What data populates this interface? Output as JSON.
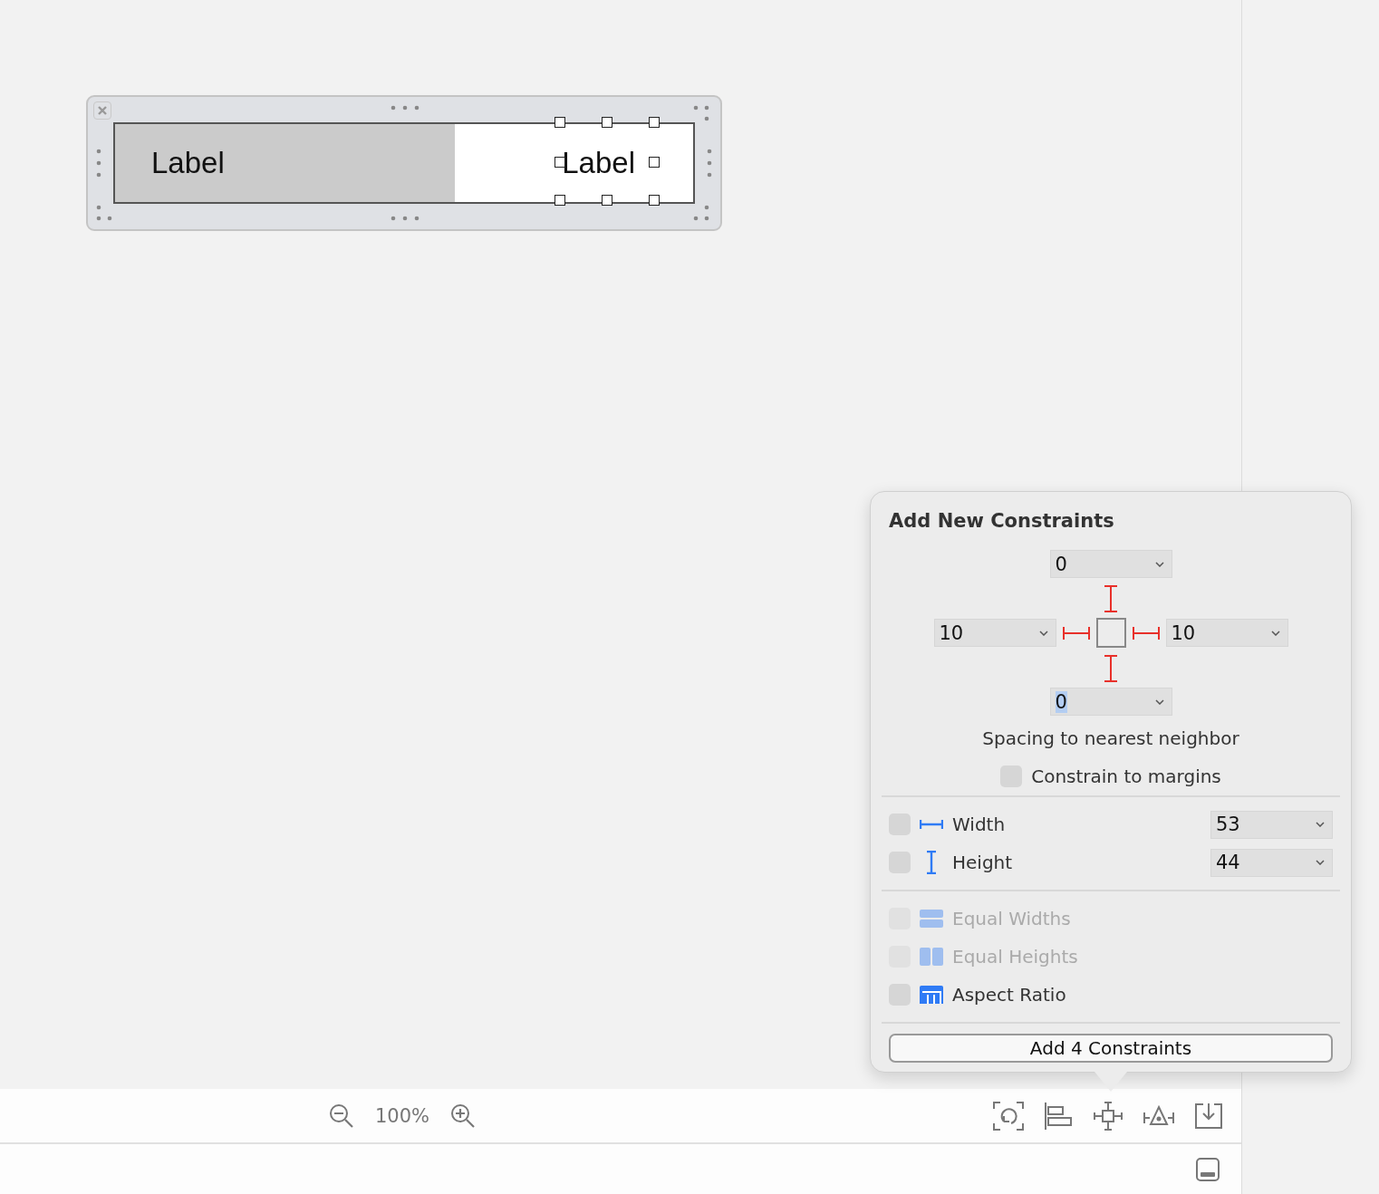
{
  "canvas": {
    "labels": [
      {
        "text": "Label",
        "selected": false
      },
      {
        "text": "Label",
        "selected": true
      }
    ]
  },
  "popover": {
    "title": "Add New Constraints",
    "spacing": {
      "top": {
        "value": "0",
        "pinned": true,
        "focused": false
      },
      "left": {
        "value": "10",
        "pinned": true,
        "focused": false
      },
      "right": {
        "value": "10",
        "pinned": true,
        "focused": false
      },
      "bottom": {
        "value": "0",
        "pinned": true,
        "focused": true
      }
    },
    "spacing_caption": "Spacing to nearest neighbor",
    "constrain_to_margins": {
      "label": "Constrain to margins",
      "checked": false
    },
    "size_rows": [
      {
        "kind": "width",
        "label": "Width",
        "value": "53",
        "checked": false
      },
      {
        "kind": "height",
        "label": "Height",
        "value": "44",
        "checked": false
      }
    ],
    "relation_rows": [
      {
        "kind": "equal-widths",
        "label": "Equal Widths",
        "checked": false,
        "disabled": true
      },
      {
        "kind": "equal-heights",
        "label": "Equal Heights",
        "checked": false,
        "disabled": true
      },
      {
        "kind": "aspect-ratio",
        "label": "Aspect Ratio",
        "checked": false,
        "disabled": false
      }
    ],
    "add_button": "Add 4 Constraints"
  },
  "toolbar": {
    "zoom": "100%"
  }
}
